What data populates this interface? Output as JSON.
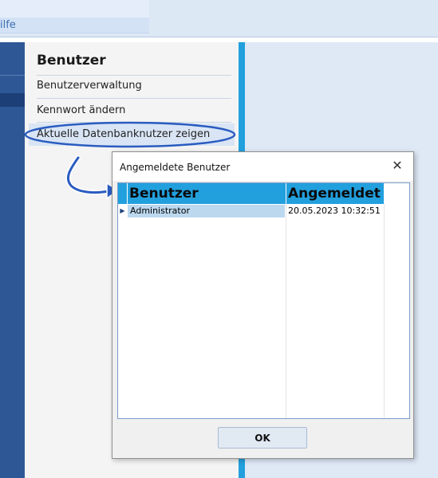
{
  "menubar": {
    "help_label": "ilfe"
  },
  "panel": {
    "title": "Benutzer",
    "items": [
      {
        "label": "Benutzerverwaltung"
      },
      {
        "label": "Kennwort ändern"
      },
      {
        "label": "Aktuelle Datenbanknutzer zeigen"
      }
    ]
  },
  "dialog": {
    "title": "Angemeldete Benutzer",
    "close_glyph": "✕",
    "columns": {
      "user": "Benutzer",
      "logged_in": "Angemeldet"
    },
    "rows": [
      {
        "user": "Administrator",
        "logged_in": "20.05.2023 10:32:51"
      }
    ],
    "ok_label": "OK"
  },
  "colors": {
    "accent": "#22a0de",
    "sidebar": "#2e5796",
    "selected_row": "#bcd8ee"
  }
}
